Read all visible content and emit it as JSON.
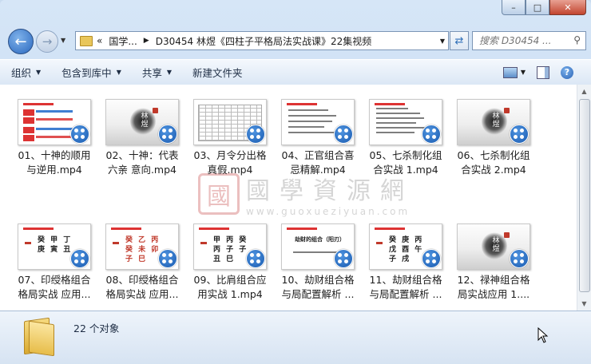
{
  "window": {
    "controls": {
      "minimize": "–",
      "maximize": "□",
      "close": "✕"
    }
  },
  "nav": {
    "back_glyph": "←",
    "forward_glyph": "→",
    "address": {
      "prefix": "«",
      "segments": [
        "国学...",
        "D30454 林煜《四柱子平格局法实战课》22集视频"
      ]
    },
    "search_placeholder": "搜索 D30454 ..."
  },
  "toolbar": {
    "organize": "组织",
    "include_library": "包含到库中",
    "share": "共享",
    "new_folder": "新建文件夹"
  },
  "watermark": {
    "logo_char": "國",
    "text": "國學資源網",
    "url": "www.guoxueziyuan.com"
  },
  "files": [
    {
      "name": "01、十神的顺用与逆用.mp4",
      "thumb": "red-bars",
      "lines": [
        "财旺印衰",
        "为破局:",
        "金水伤官",
        "为破局:"
      ]
    },
    {
      "name": "02、十神：代表六亲 意向.mp4",
      "thumb": "ink",
      "ink_text": "林 煜"
    },
    {
      "name": "03、月令分出格真假.mp4",
      "thumb": "grid"
    },
    {
      "name": "04、正官组合喜忌精解.mp4",
      "thumb": "text-lines"
    },
    {
      "name": "05、七杀制化组合实战 1.mp4",
      "thumb": "text-lines-2"
    },
    {
      "name": "06、七杀制化组合实战 2.mp4",
      "thumb": "ink",
      "ink_text": "林 煜"
    },
    {
      "name": "07、印绶格组合格局实战 应用...",
      "thumb": "chars",
      "chars": "癸 甲 丁 庚 寅 丑"
    },
    {
      "name": "08、印绶格组合格局实战 应用...",
      "thumb": "chars-red",
      "chars": "癸 乙 丙 癸 未 卯 子 巳"
    },
    {
      "name": "09、比肩组合应用实战 1.mp4",
      "thumb": "chars",
      "chars": "甲 丙 癸 丙 子 子 丑 巳"
    },
    {
      "name": "10、劫财组合格与局配置解析 ...",
      "thumb": "title",
      "title": "劫财的组合（阳刃）"
    },
    {
      "name": "11、劫财组合格与局配置解析 ...",
      "thumb": "chars",
      "chars": "癸 庚 丙 戊 酉 午 子 戌"
    },
    {
      "name": "12、禄神组合格局实战应用 1....",
      "thumb": "ink",
      "ink_text": "林 煜"
    }
  ],
  "status": {
    "count": "22 个对象"
  }
}
